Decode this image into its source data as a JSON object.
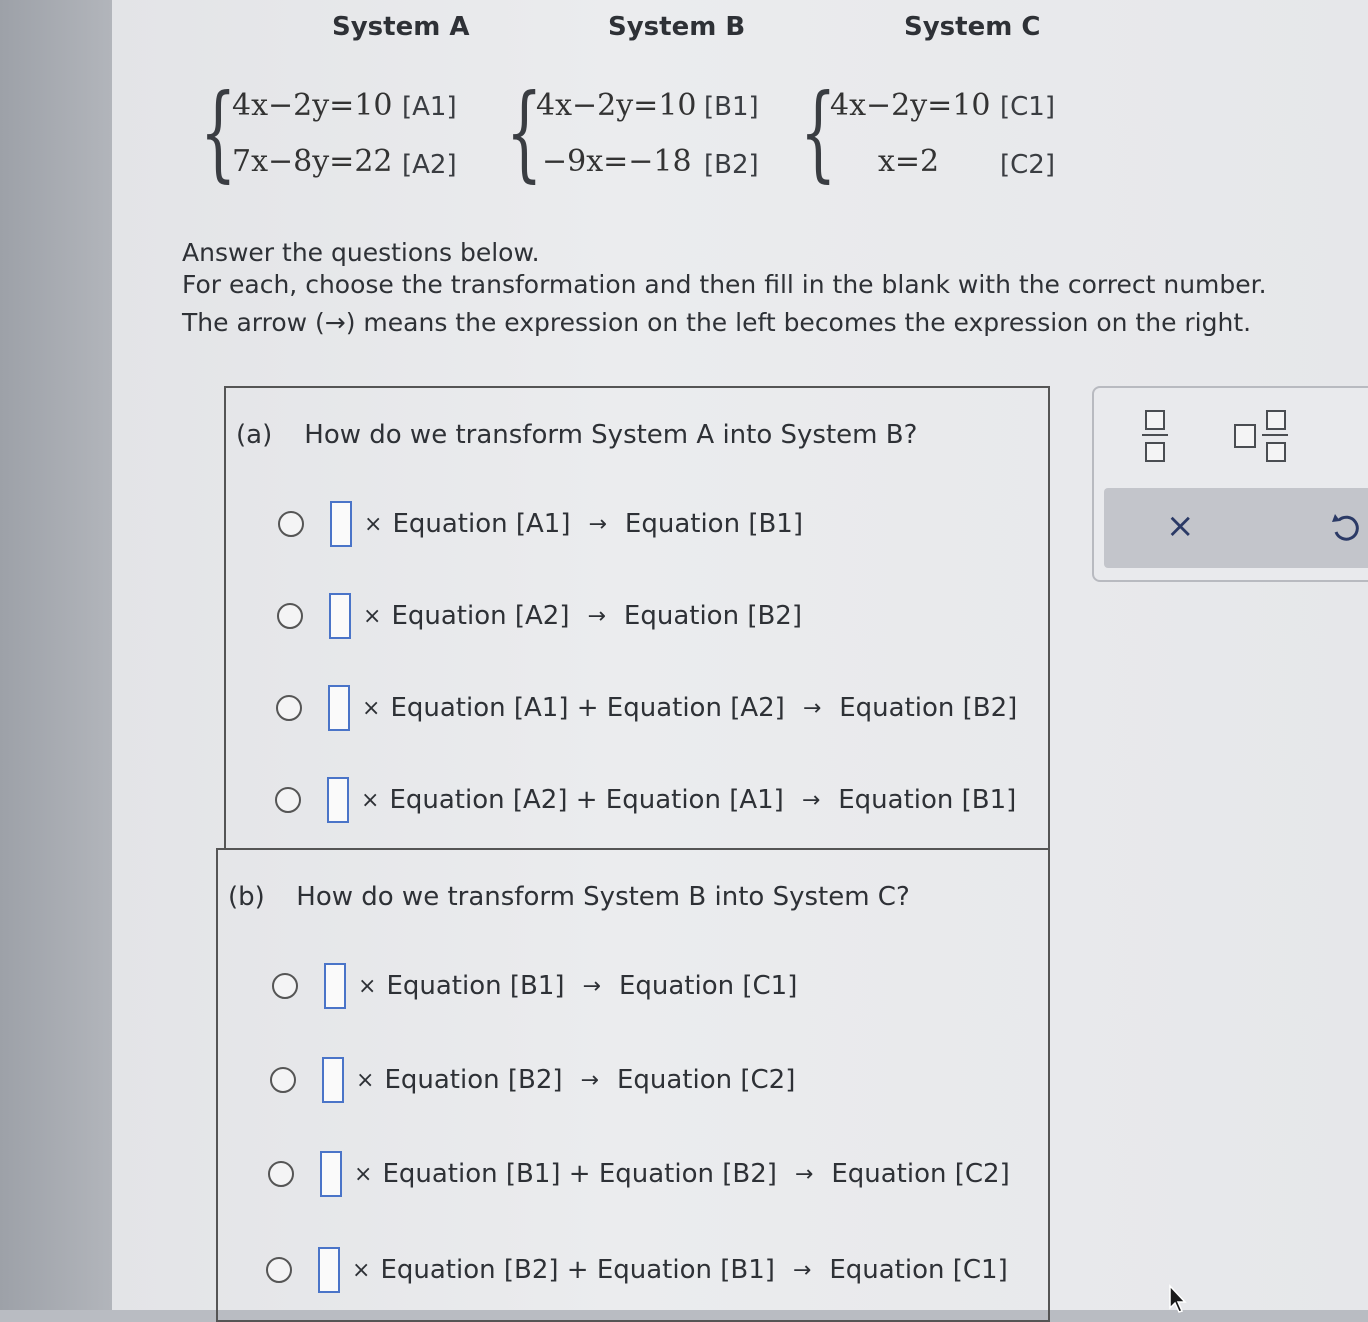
{
  "systems": [
    {
      "title": "System A",
      "eq1": "4x−2y=10",
      "tag1": "[A1]",
      "eq2": "7x−8y=22",
      "tag2": "[A2]"
    },
    {
      "title": "System B",
      "eq1": "4x−2y=10",
      "tag1": "[B1]",
      "eq2": "−9x=−18",
      "tag2": "[B2]"
    },
    {
      "title": "System C",
      "eq1": "4x−2y=10",
      "tag1": "[C1]",
      "eq2": "x=2",
      "tag2": "[C2]"
    }
  ],
  "instructions": {
    "line1": "Answer the questions below.",
    "line2": "For each, choose the transformation and then fill in the blank with the correct number.",
    "line3": "The arrow (→) means the expression on the left becomes the expression on the right."
  },
  "part_a": {
    "label": "(a)",
    "question": "How do we transform System A into System B?",
    "options": [
      {
        "left": "Equation [A1]",
        "right": "Equation [B1]"
      },
      {
        "left": "Equation [A2]",
        "right": "Equation [B2]"
      },
      {
        "left": "Equation [A1] + Equation [A2]",
        "right": "Equation [B2]"
      },
      {
        "left": "Equation [A2] + Equation [A1]",
        "right": "Equation [B1]"
      }
    ]
  },
  "part_b": {
    "label": "(b)",
    "question": "How do we transform System B into System C?",
    "options": [
      {
        "left": "Equation [B1]",
        "right": "Equation [C1]"
      },
      {
        "left": "Equation [B2]",
        "right": "Equation [C2]"
      },
      {
        "left": "Equation [B1] + Equation [B2]",
        "right": "Equation [C2]"
      },
      {
        "left": "Equation [B2] + Equation [B1]",
        "right": "Equation [C1]"
      }
    ]
  },
  "symbols": {
    "times": "×",
    "arrow": "→"
  },
  "toolbox": {
    "clear_symbol": "×",
    "icons": [
      "fraction-icon",
      "mixed-number-icon",
      "undo-icon"
    ]
  }
}
